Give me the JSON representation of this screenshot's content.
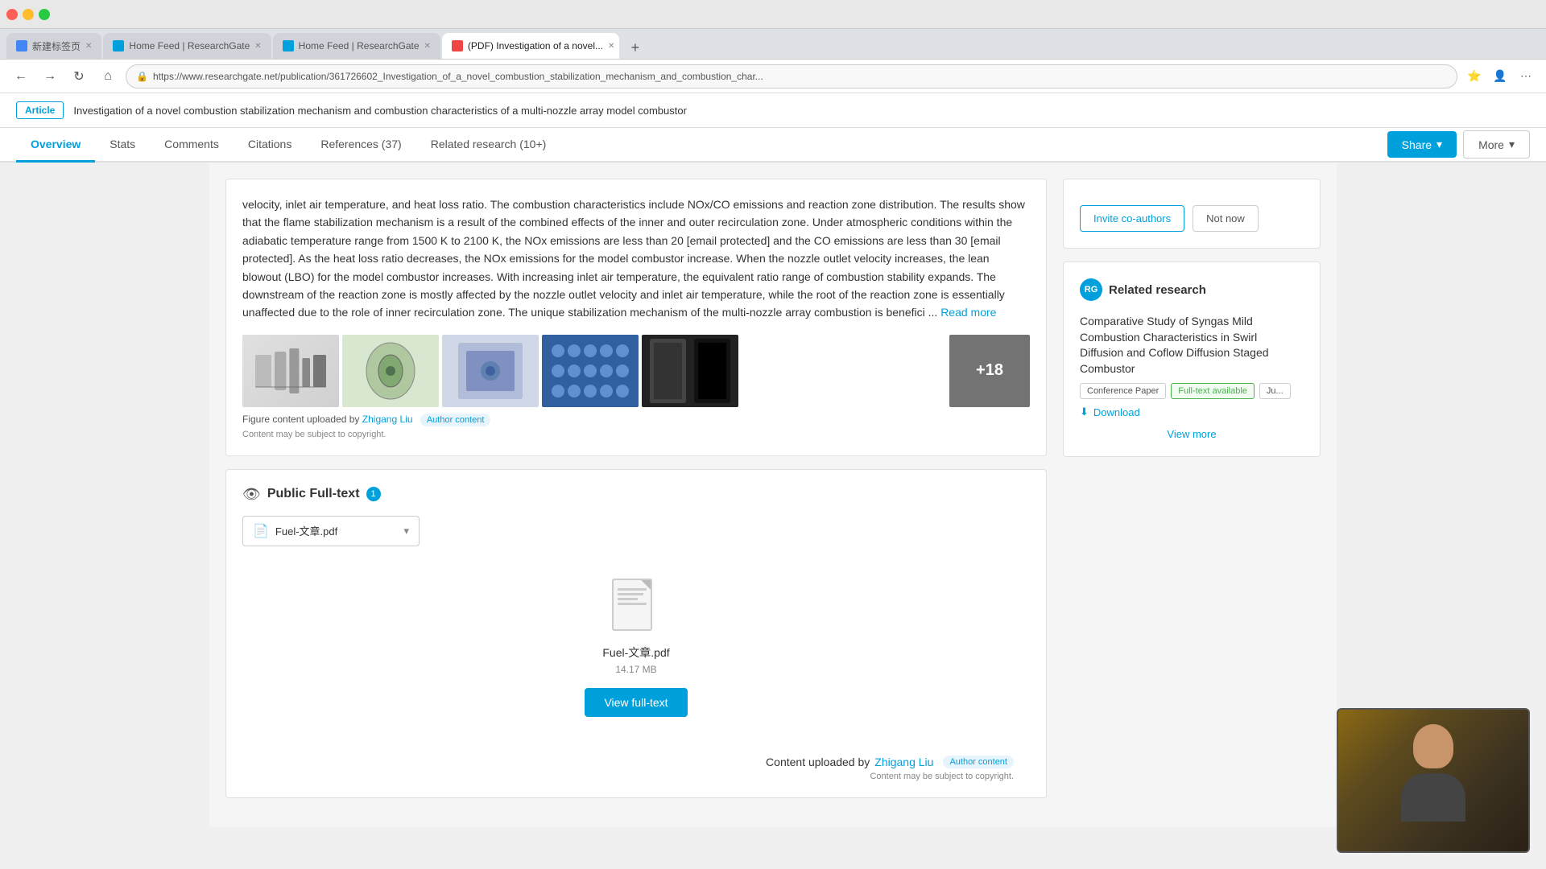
{
  "browser": {
    "tabs": [
      {
        "id": "tab1",
        "label": "新建标签页",
        "active": false,
        "favicon": "blue"
      },
      {
        "id": "tab2",
        "label": "Home Feed | ResearchGate",
        "active": false,
        "favicon": "rg"
      },
      {
        "id": "tab3",
        "label": "Home Feed | ResearchGate",
        "active": false,
        "favicon": "rg"
      },
      {
        "id": "tab4",
        "label": "(PDF) Investigation of a novel...",
        "active": true,
        "favicon": "pdf"
      }
    ],
    "address": "https://www.researchgate.net/publication/361726602_Investigation_of_a_novel_combustion_stabilization_mechanism_and_combustion_char..."
  },
  "article_banner": {
    "tag": "Article",
    "title": "Investigation of a novel combustion stabilization mechanism and combustion characteristics of a multi-nozzle array model combustor"
  },
  "nav_tabs": [
    {
      "id": "overview",
      "label": "Overview",
      "active": true
    },
    {
      "id": "stats",
      "label": "Stats",
      "active": false
    },
    {
      "id": "comments",
      "label": "Comments",
      "active": false
    },
    {
      "id": "citations",
      "label": "Citations",
      "active": false
    },
    {
      "id": "references",
      "label": "References (37)",
      "active": false
    },
    {
      "id": "related",
      "label": "Related research (10+)",
      "active": false
    }
  ],
  "toolbar": {
    "share_label": "Share",
    "more_label": "More"
  },
  "abstract": {
    "text": "velocity, inlet air temperature, and heat loss ratio. The combustion characteristics include NOx/CO emissions and reaction zone distribution. The results show that the flame stabilization mechanism is a result of the combined effects of the inner and outer recirculation zone. Under atmospheric conditions within the adiabatic temperature range from 1500 K to 2100 K, the NOx emissions are less than 20 [email protected] and the CO emissions are less than 30 [email protected]. As the heat loss ratio decreases, the NOx emissions for the model combustor increase. When the nozzle outlet velocity increases, the lean blowout (LBO) for the model combustor increases. With increasing inlet air temperature, the equivalent ratio range of combustion stability expands. The downstream of the reaction zone is mostly affected by the nozzle outlet velocity and inlet air temperature, while the root of the reaction zone is essentially unaffected due to the role of inner recirculation zone. The unique stabilization mechanism of the multi-nozzle array combustion is benefici ...",
    "read_more": "Read more",
    "figure_caption": "Figure content uploaded by",
    "figure_author": "Zhigang Liu",
    "author_content": "Author content",
    "copyright": "Content may be subject to copyright.",
    "figure_count": "+18"
  },
  "fulltext_section": {
    "title": "Public Full-text",
    "info": "1",
    "file_name": "Fuel-文章.pdf",
    "pdf_filename": "Fuel-文章.pdf",
    "pdf_size": "14.17 MB",
    "view_fulltext": "View full-text",
    "content_uploaded_by": "Content uploaded by",
    "uploader": "Zhigang Liu",
    "author_content": "Author content",
    "copyright": "Content may be subject to copyright."
  },
  "sidebar": {
    "invite_label": "Invite co-authors",
    "not_now_label": "Not now",
    "related_research_title": "Related research",
    "paper": {
      "title": "Comparative Study of Syngas Mild Combustion Characteristics in Swirl Diffusion and Coflow Diffusion Staged Combustor",
      "badge_type": "Conference Paper",
      "badge_fulltext": "Full-text available",
      "badge_journal": "Ju...",
      "download": "Download"
    },
    "view_more": "View more"
  },
  "icons": {
    "back": "←",
    "forward": "→",
    "refresh": "↻",
    "home": "⌂",
    "lock": "🔒",
    "share_chevron": "▾",
    "more_chevron": "▾",
    "eye": "👁",
    "download_icon": "⬇",
    "info_icon": "i",
    "file_icon": "📄",
    "chevron": "▾"
  }
}
